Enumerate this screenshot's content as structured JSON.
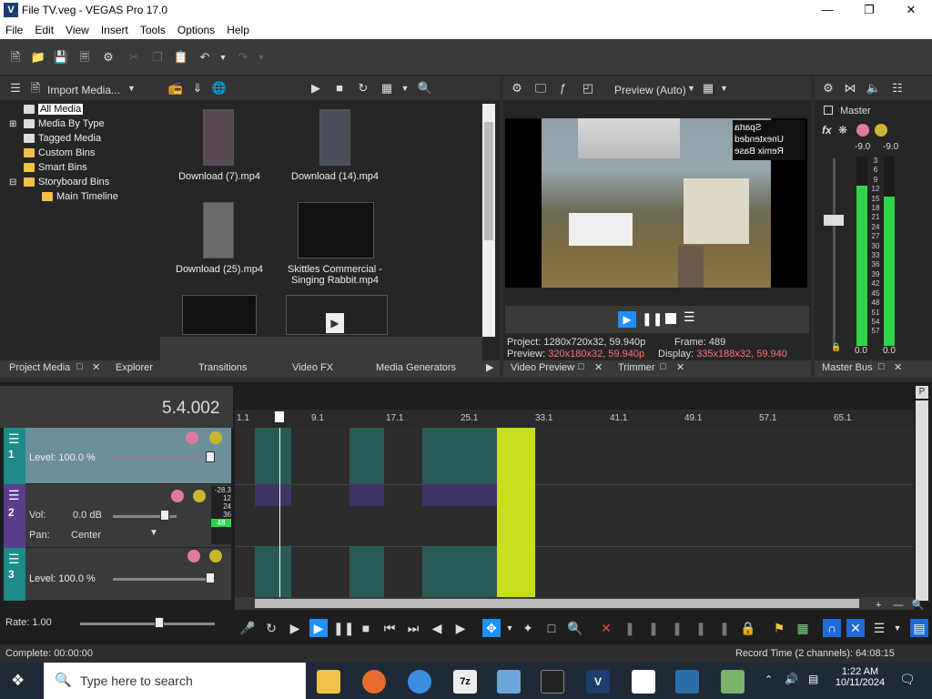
{
  "window": {
    "title": "File TV.veg - VEGAS Pro 17.0",
    "app_icon": "V"
  },
  "menu": [
    "File",
    "Edit",
    "View",
    "Insert",
    "Tools",
    "Options",
    "Help"
  ],
  "media_toolbar": {
    "import_label": "Import Media..."
  },
  "tree": [
    "All Media",
    "Media By Type",
    "Tagged Media",
    "Custom Bins",
    "Smart Bins",
    "Storyboard Bins",
    "Main Timeline"
  ],
  "media": [
    {
      "label": "Download (7).mp4"
    },
    {
      "label": "Download (14).mp4"
    },
    {
      "label": "Download (25).mp4"
    },
    {
      "label": "Skittles Commercial - Singing Rabbit.mp4"
    }
  ],
  "left_tabs": [
    "Project Media",
    "Explorer",
    "Transitions",
    "Video FX",
    "Media Generators"
  ],
  "preview": {
    "mode": "Preview (Auto)",
    "overlay_text": "Sparta\nUnextended\nRemix Base",
    "project_label": "Project:",
    "project": "1280x720x32, 59.940p",
    "frame_label": "Frame:",
    "frame": "489",
    "preview_label": "Preview:",
    "preview_val": "320x180x32, 59.940p",
    "display_label": "Display:",
    "display": "335x188x32, 59.940",
    "tabs": [
      "Video Preview",
      "Trimmer"
    ]
  },
  "master": {
    "label": "Master",
    "peak_l": "-9.0",
    "peak_r": "-9.0",
    "scale": [
      "3",
      "6",
      "9",
      "12",
      "15",
      "18",
      "21",
      "24",
      "27",
      "30",
      "33",
      "36",
      "39",
      "42",
      "45",
      "48",
      "51",
      "54",
      "57"
    ],
    "bottom_l": "0.0",
    "bottom_r": "0.0",
    "tab": "Master Bus"
  },
  "timeline": {
    "timecode": "5.4.002",
    "ruler": [
      "1.1",
      "9.1",
      "17.1",
      "25.1",
      "33.1",
      "41.1",
      "49.1",
      "57.1",
      "65.1"
    ],
    "tracks": [
      {
        "num": "1",
        "label": "Level:",
        "value": "100.0 %"
      },
      {
        "num": "2",
        "vol_label": "Vol:",
        "vol": "0.0 dB",
        "pan_label": "Pan:",
        "pan": "Center",
        "meter": [
          "-28.3",
          "12",
          "24",
          "36",
          "48"
        ]
      },
      {
        "num": "3",
        "label": "Level:",
        "value": "100.0 %"
      }
    ],
    "rate": "Rate: 1.00"
  },
  "status": {
    "left": "Complete: 00:00:00",
    "right": "Record Time (2 channels): 64:08:15"
  },
  "taskbar": {
    "search": "Type here to search",
    "time": "1:22 AM",
    "date": "10/11/2024"
  }
}
